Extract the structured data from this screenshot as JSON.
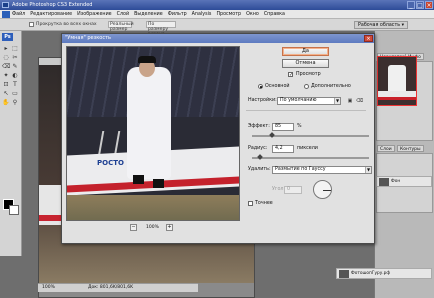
{
  "app": {
    "title": "Adobe Photoshop CS3 Extended",
    "win_min": "_",
    "win_max": "□",
    "win_close": "×"
  },
  "menu": [
    "Файл",
    "Редактирование",
    "Изображение",
    "Слой",
    "Выделение",
    "Фильтр",
    "Analysis",
    "Просмотр",
    "Окно",
    "Справка"
  ],
  "options": {
    "scroll_all_label": "Прокрутка во всех окнах",
    "actual_pixels": "Реальный размер",
    "fit_screen": "По размеру экрана",
    "workspace": "Рабочая область ▾"
  },
  "tools": {
    "ps": "Ps",
    "glyphs": [
      "▸",
      "⬚",
      "◌",
      "✂",
      "⌫",
      "✎",
      "✦",
      "◐",
      "⊡",
      "T",
      "↖",
      "▭",
      "✋",
      "⚲"
    ]
  },
  "dialog": {
    "title": "\"Умная\" резкость",
    "close": "×",
    "ok": "Да",
    "cancel": "Отмена",
    "preview_label": "Просмотр",
    "preview_checked": "✓",
    "mode_basic": "Основной",
    "mode_advanced": "Дополнительно",
    "settings_label": "Настройки:",
    "settings_value": "По умолчанию",
    "amount_label": "Эффект:",
    "amount_value": "85",
    "amount_unit": "%",
    "amount_level": 0.17,
    "radius_label": "Радиус:",
    "radius_value": "4,2",
    "radius_unit": "пиксели",
    "radius_level": 0.07,
    "remove_label": "Удалить:",
    "remove_value": "Размытие по Гауссу",
    "angle_label": "Угол:",
    "angle_value": "0",
    "more_accurate": "Точнее",
    "zoom_value": "100%",
    "zoom_minus": "−",
    "zoom_plus": "+",
    "plane_text": "РОСТО"
  },
  "panels": {
    "tab1": "Навигатор",
    "tab2": "Инфо",
    "tab3": "Слои",
    "tab4": "Контуры",
    "layer_name": "Фон",
    "layer2": "ФотошопГуру.рф"
  },
  "status": {
    "zoom": "100%",
    "doc": "Док: 801,6K/801,6K"
  }
}
